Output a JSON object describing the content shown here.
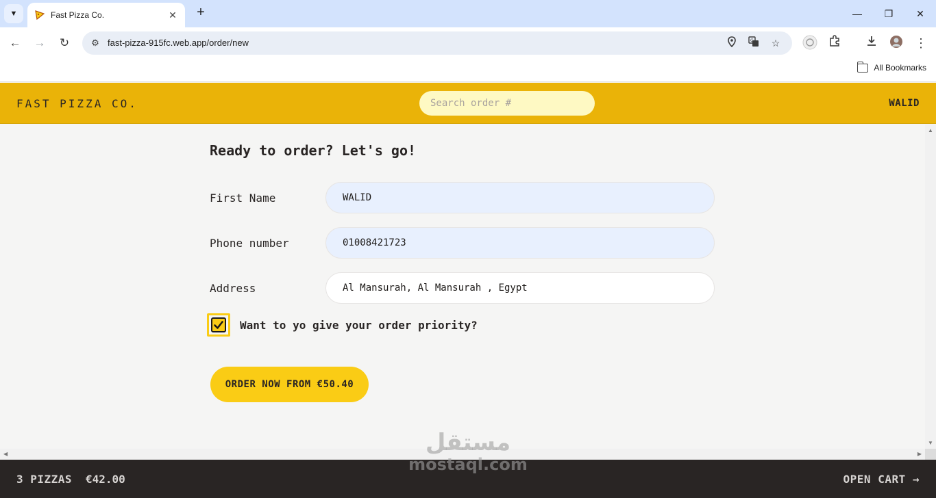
{
  "browser": {
    "tab_title": "Fast Pizza Co.",
    "url": "fast-pizza-915fc.web.app/order/new",
    "bookmarks_label": "All Bookmarks"
  },
  "header": {
    "logo": "FAST PIZZA CO.",
    "search_placeholder": "Search order #",
    "username": "WALID"
  },
  "form": {
    "title": "Ready to order? Let's go!",
    "first_name_label": "First Name",
    "first_name_value": "WALID",
    "phone_label": "Phone number",
    "phone_value": "01008421723",
    "address_label": "Address",
    "address_value": "Al Mansurah, Al Mansurah , Egypt",
    "priority_label": "Want to yo give your order priority?",
    "priority_checked": true,
    "submit_label": "ORDER NOW FROM €50.40"
  },
  "cart": {
    "count": "3 PIZZAS",
    "total": "€42.00",
    "open_label": "OPEN CART →"
  },
  "watermark": {
    "arabic": "مستقل",
    "latin": "mostaql.com"
  },
  "colors": {
    "header_bg": "#eab308",
    "accent": "#facc15",
    "cart_bg": "#292524"
  }
}
